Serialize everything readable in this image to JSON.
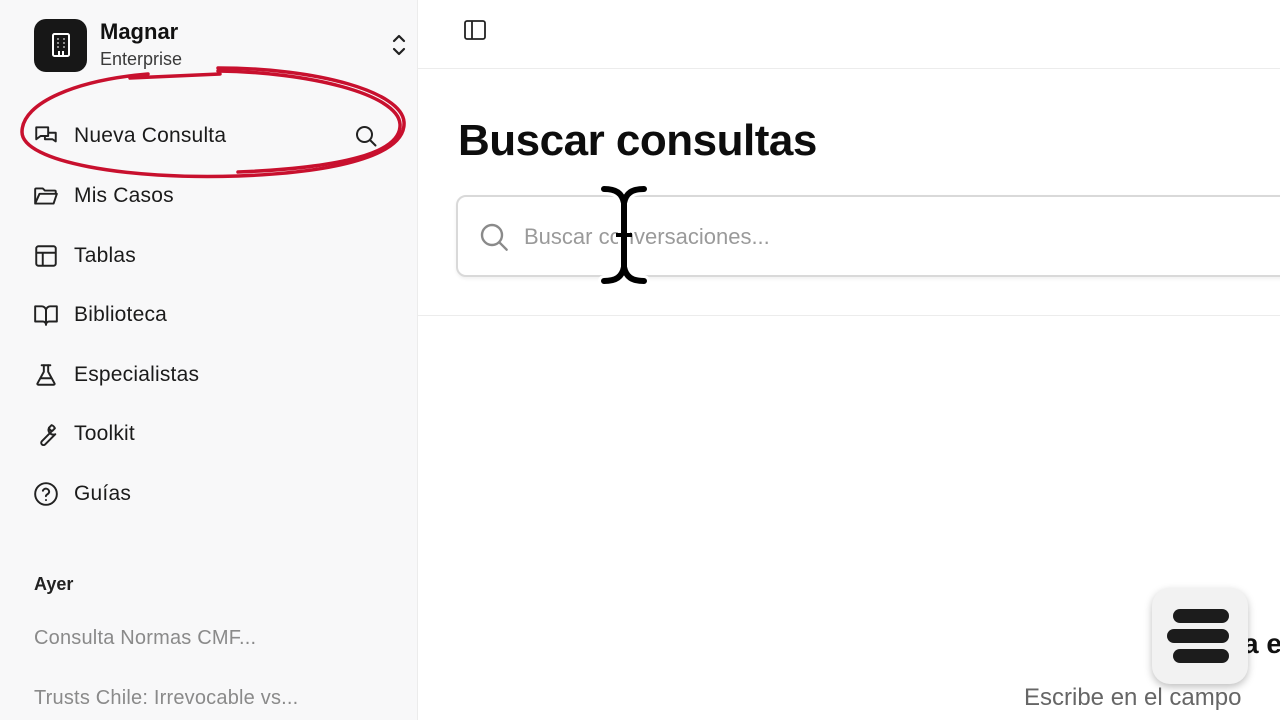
{
  "workspace": {
    "name": "Magnar",
    "plan": "Enterprise"
  },
  "nav": [
    {
      "label": "Nueva Consulta",
      "icon": "chat-bubbles-icon"
    },
    {
      "label": "Mis Casos",
      "icon": "folder-icon"
    },
    {
      "label": "Tablas",
      "icon": "table-icon"
    },
    {
      "label": "Biblioteca",
      "icon": "book-icon"
    },
    {
      "label": "Especialistas",
      "icon": "flask-icon"
    },
    {
      "label": "Toolkit",
      "icon": "wrench-icon"
    },
    {
      "label": "Guías",
      "icon": "help-circle-icon"
    }
  ],
  "history": {
    "title": "Ayer",
    "items": [
      "Consulta Normas CMF...",
      "Trusts Chile: Irrevocable vs..."
    ]
  },
  "main": {
    "title": "Buscar consultas",
    "search_placeholder": "Buscar conversaciones...",
    "empty_title_partial": "a e",
    "empty_desc_partial": "Escribe en el campo"
  },
  "colors": {
    "highlight": "#c8102e",
    "logo_bg": "#171717"
  }
}
